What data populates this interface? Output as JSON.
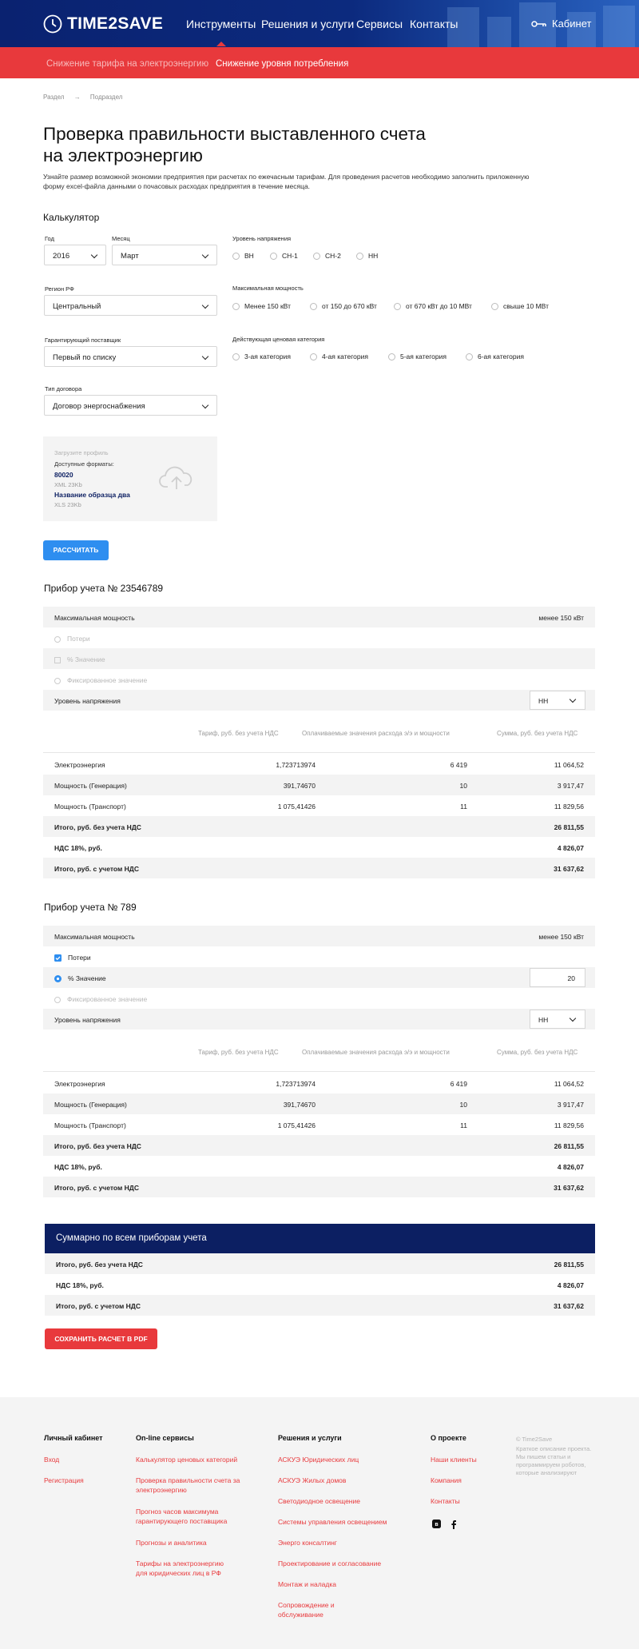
{
  "header": {
    "logo": "TIME2SAVE",
    "nav": [
      "Инструменты",
      "Решения и услуги",
      "Сервисы",
      "Контакты"
    ],
    "cabinet": "Кабинет"
  },
  "subnav": {
    "item1": "Снижение тарифа на электроэнергию",
    "item2": "Снижение уровня потребления"
  },
  "breadcrumb": {
    "section": "Раздел",
    "arrow": "→",
    "subsection": "Подраздел"
  },
  "page": {
    "title_line1": "Проверка правильности выставленного счета",
    "title_line2": "на электроэнергию",
    "intro": "Узнайте размер возможной экономии предприятия при расчетах по ежечасным тарифам. Для проведения расчетов необходимо заполнить приложенную форму excel-файла данными о почасовых расходах предприятия в течение месяца."
  },
  "calc": {
    "title": "Калькулятор",
    "year_label": "Год",
    "year": "2016",
    "month_label": "Месяц",
    "month": "Март",
    "region_label": "Регион РФ",
    "region": "Центральный",
    "supplier_label": "Гарантирующий поставщик",
    "supplier": "Первый по списку",
    "contract_label": "Тип договора",
    "contract": "Договор энергоснабжения",
    "voltage_label": "Уровень напряжения",
    "voltages": [
      "ВН",
      "СН-1",
      "СН-2",
      "НН"
    ],
    "power_label": "Максимальная мощность",
    "powers": [
      "Менее 150 кВт",
      "от 150 до 670 кВт",
      "от 670 кВт до 10 МВт",
      "свыше 10 МВт"
    ],
    "price_label": "Действующая ценовая категория",
    "prices": [
      "3-ая категория",
      "4-ая категория",
      "5-ая категория",
      "6-ая категория"
    ],
    "upload": {
      "title": "Загрузите профиль",
      "formats": "Доступные форматы:",
      "file1": "80020",
      "file1_info": "XML 23Kb",
      "file2": "Название образца два",
      "file2_info": "XLS 23Kb"
    },
    "button": "РАССЧИТАТЬ"
  },
  "meter1": {
    "title": "Прибор учета № 23546789",
    "max_power_label": "Максимальная мощность",
    "max_power": "менее 150 кВт",
    "losses": "Потери",
    "percent": "% Значение",
    "fixed": "Фиксированное значение",
    "voltage_label": "Уровень напряжения",
    "voltage": "НН"
  },
  "meter2": {
    "title": "Прибор учета № 789",
    "max_power_label": "Максимальная мощность",
    "max_power": "менее 150 кВт",
    "losses": "Потери",
    "percent": "% Значение",
    "percent_value": "20",
    "fixed": "Фиксированное значение",
    "voltage_label": "Уровень напряжения",
    "voltage": "НН"
  },
  "table": {
    "col1": "Тариф, руб. без учета НДС",
    "col2": "Оплачиваемые значения расхода э/э и мощности",
    "col3": "Сумма, руб. без учета НДС",
    "rows": [
      {
        "name": "Электроэнергия",
        "tariff": "1,723713974",
        "qty": "6 419",
        "sum": "11 064,52"
      },
      {
        "name": "Мощность (Генерация)",
        "tariff": "391,74670",
        "qty": "10",
        "sum": "3 917,47"
      },
      {
        "name": "Мощность (Транспорт)",
        "tariff": "1 075,41426",
        "qty": "11",
        "sum": "11 829,56"
      }
    ],
    "total_label": "Итого, руб. без учета НДС",
    "total": "26 811,55",
    "vat_label": "НДС 18%, руб.",
    "vat": "4 826,07",
    "total_vat_label": "Итого, руб. с учетом НДС",
    "total_vat": "31 637,62"
  },
  "summary": {
    "title": "Суммарно по всем приборам учета",
    "total_label": "Итого, руб. без учета НДС",
    "total": "26 811,55",
    "vat_label": "НДС 18%, руб.",
    "vat": "4 826,07",
    "total_vat_label": "Итого, руб. с учетом НДС",
    "total_vat": "31 637,62",
    "save_button": "СОХРАНИТЬ РАСЧЕТ В PDF"
  },
  "footer": {
    "col1_title": "Личный кабинет",
    "col1": [
      "Вход",
      "Регистрация"
    ],
    "col2_title": "On-line сервисы",
    "col2": [
      "Калькулятор ценовых категорий",
      "Проверка правильности счета за электроэнергию",
      "Прогноз часов максимума гарантирующего поставщика",
      "Прогнозы и аналитика",
      "Тарифы на электроэнергию для юридических лиц в РФ"
    ],
    "col3_title": "Решения и услуги",
    "col3": [
      "АСКУЭ Юридических лиц",
      "АСКУЭ Жилых домов",
      "Светодиодное освещение",
      "Системы управления освещением",
      "Энерго консалтинг",
      "Проектирование и согласование",
      "Монтаж и наладка",
      "Сопровождение и обслуживание"
    ],
    "col4_title": "О проекте",
    "col4": [
      "Наши клиенты",
      "Компания",
      "Контакты"
    ],
    "social": [
      "vk-icon",
      "facebook-icon"
    ],
    "copyright": "© Time2Save",
    "about": "Краткое описание проекта. Мы пишем статьи и программируем роботов, которые анализируют"
  },
  "colors": {
    "navy": "#0c1f62",
    "red": "#e8393c",
    "blue": "#2e8ef0"
  }
}
